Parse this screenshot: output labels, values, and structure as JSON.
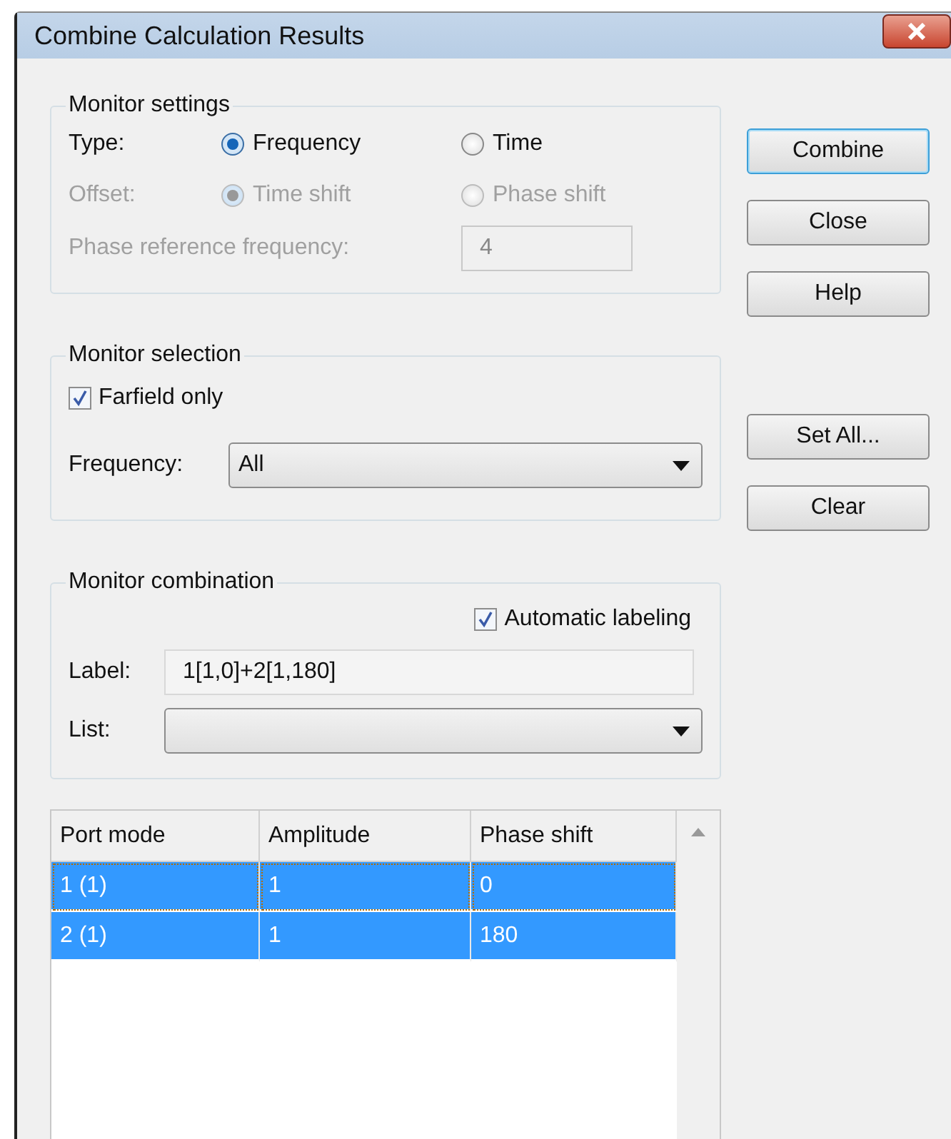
{
  "window": {
    "title": "Combine Calculation Results"
  },
  "monitor_settings": {
    "title": "Monitor settings",
    "type": {
      "label": "Type:",
      "options": [
        {
          "label": "Frequency",
          "selected": true
        },
        {
          "label": "Time",
          "selected": false
        }
      ]
    },
    "offset": {
      "label": "Offset:",
      "disabled": true,
      "options": [
        {
          "label": "Time shift",
          "selected": true
        },
        {
          "label": "Phase shift",
          "selected": false
        }
      ]
    },
    "phase_reference": {
      "label": "Phase reference frequency:",
      "value": "4",
      "disabled": true
    }
  },
  "monitor_selection": {
    "title": "Monitor selection",
    "farfield_only": {
      "label": "Farfield only",
      "checked": true
    },
    "frequency": {
      "label": "Frequency:",
      "value": "All"
    }
  },
  "monitor_combination": {
    "title": "Monitor combination",
    "automatic_labeling": {
      "label": "Automatic labeling",
      "checked": true
    },
    "label_field": {
      "label": "Label:",
      "value": "1[1,0]+2[1,180]"
    },
    "list": {
      "label": "List:"
    }
  },
  "table": {
    "columns": [
      "Port mode",
      "Amplitude",
      "Phase shift"
    ],
    "rows": [
      {
        "cells": [
          "1 (1)",
          "1",
          "0"
        ],
        "selected": true,
        "focused": true
      },
      {
        "cells": [
          "2 (1)",
          "1",
          "180"
        ],
        "selected": true,
        "focused": false
      }
    ]
  },
  "buttons_top": [
    {
      "label": "Combine",
      "default": true
    },
    {
      "label": "Close",
      "default": false
    },
    {
      "label": "Help",
      "default": false
    }
  ],
  "buttons_bottom": [
    {
      "label": "Set All...",
      "default": false
    },
    {
      "label": "Clear",
      "default": false
    }
  ]
}
